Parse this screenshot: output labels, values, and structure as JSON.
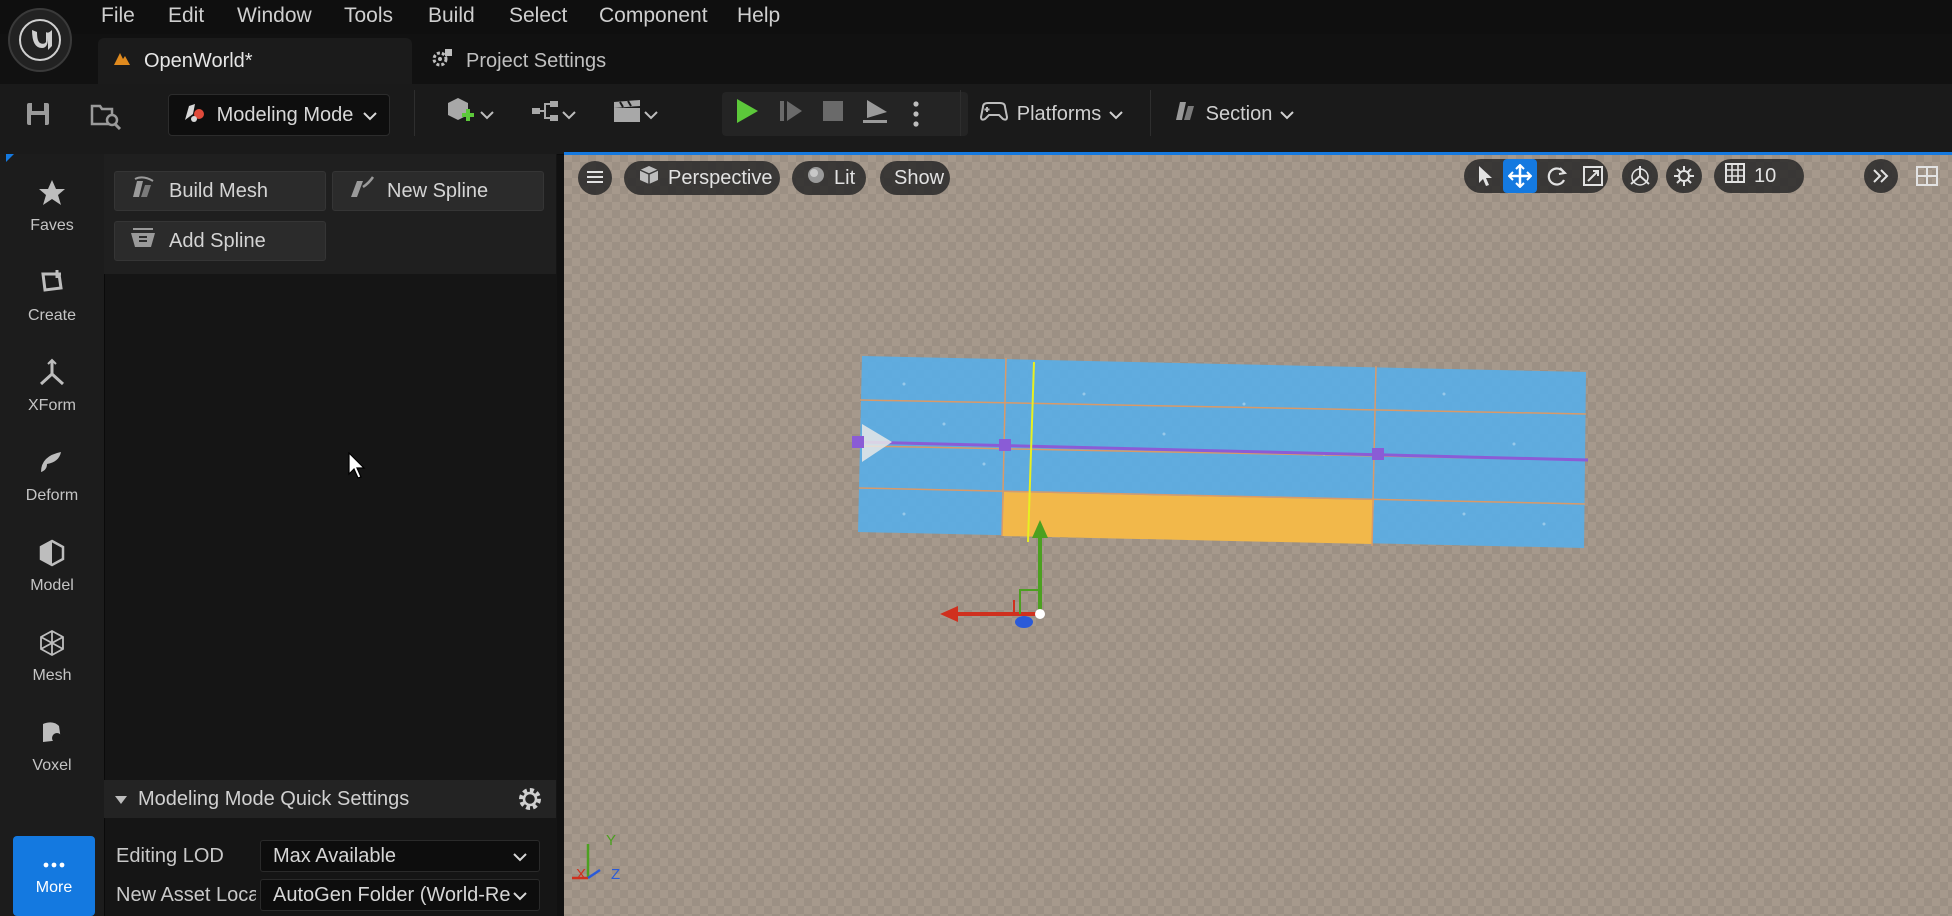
{
  "menu": {
    "items": [
      "File",
      "Edit",
      "Window",
      "Tools",
      "Build",
      "Select",
      "Component",
      "Help"
    ]
  },
  "tabs": {
    "level_tab": "OpenWorld*",
    "settings_tab": "Project Settings"
  },
  "toolbar": {
    "mode_label": "Modeling Mode",
    "platforms_label": "Platforms",
    "section_label": "Section"
  },
  "mode_strip": {
    "items": [
      {
        "label": "Faves",
        "icon": "star-icon"
      },
      {
        "label": "Create",
        "icon": "create-icon"
      },
      {
        "label": "XForm",
        "icon": "xform-icon"
      },
      {
        "label": "Deform",
        "icon": "deform-icon"
      },
      {
        "label": "Model",
        "icon": "model-icon"
      },
      {
        "label": "Mesh",
        "icon": "mesh-icon"
      },
      {
        "label": "Voxel",
        "icon": "voxel-icon"
      }
    ],
    "more_label": "More"
  },
  "tools": {
    "build_mesh": "Build Mesh",
    "new_spline": "New Spline",
    "add_spline": "Add Spline"
  },
  "quick_settings": {
    "title": "Modeling Mode Quick Settings",
    "editing_lod_label": "Editing LOD",
    "editing_lod_value": "Max Available",
    "new_asset_label": "New Asset Loca",
    "new_asset_value": "AutoGen Folder (World-Re"
  },
  "viewport": {
    "perspective_label": "Perspective",
    "lit_label": "Lit",
    "show_label": "Show",
    "grid_snap_value": "10",
    "axis_labels": {
      "x": "X",
      "y": "Y",
      "z": "Z"
    }
  },
  "colors": {
    "accent": "#1479e0",
    "mesh_blue": "#5aaee6",
    "mesh_selected": "#f2b84a",
    "spline_purple": "#8a5cd6",
    "gizmo_x": "#d0301e",
    "gizmo_y": "#4ca020",
    "gizmo_z": "#2a5ad8",
    "play_green": "#5cc83a"
  }
}
